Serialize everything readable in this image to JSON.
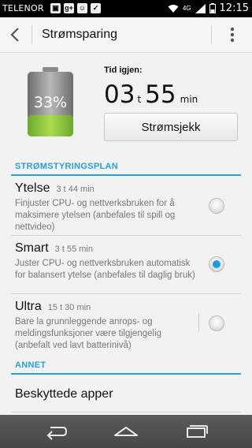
{
  "status_bar": {
    "carrier": "TELENOR",
    "network": "4G",
    "time": "12:15",
    "icons": [
      "image-icon",
      "google-plus-icon",
      "chat-icon",
      "clipboard-check-icon"
    ]
  },
  "app_bar": {
    "title": "Strømsparing"
  },
  "battery": {
    "percent_label": "33%",
    "level": 0.33,
    "remaining_label": "Tid igjen:",
    "hours": "03",
    "hours_unit": "t",
    "minutes": "55",
    "minutes_unit": "min",
    "check_button": "Strømsjekk"
  },
  "section_plan": {
    "header": "STRØMSTYRINGSPLAN",
    "plans": [
      {
        "name": "Ytelse",
        "time": "3 t 44 min",
        "description": "Finjuster CPU- og nettverksbruken for å maksimere ytelsen (anbefales til spill og nettvideo)",
        "selected": false
      },
      {
        "name": "Smart",
        "time": "3 t 55 min",
        "description": "Juster CPU- og nettverksbruken automatisk for balansert ytelse (anbefales til daglig bruk)",
        "selected": true
      },
      {
        "name": "Ultra",
        "time": "15 t 30 min",
        "description": "Bare la grunnleggende anrops- og meldingsfunksjoner være tilgjengelig (anbefalt ved lavt batterinivå)",
        "selected": false
      }
    ]
  },
  "section_other": {
    "header": "ANNET",
    "items": [
      "Beskyttede apper"
    ]
  },
  "colors": {
    "accent": "#2a9fd8",
    "battery_green": "#8cc43c"
  }
}
